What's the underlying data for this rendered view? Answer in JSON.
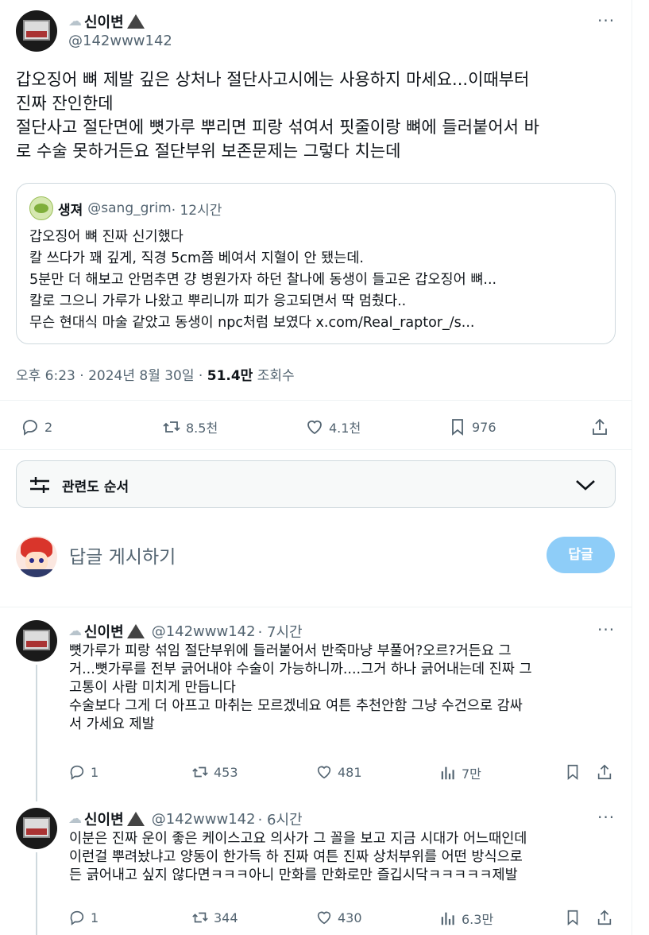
{
  "main_tweet": {
    "display_name": "신이변",
    "handle": "@142www142",
    "text_lines": [
      "갑오징어 뼈 제발 깊은 상처나 절단사고시에는 사용하지 마세요...이때부터",
      "진짜 잔인한데",
      "절단사고 절단면에 뼛가루 뿌리면 피랑 섞여서 핏줄이랑 뼈에 들러붙어서 바",
      "로 수술 못하거든요 절단부위 보존문제는 그렇다 치는데"
    ],
    "timestamp": "오후 6:23 · 2024년 8월 30일 · ",
    "views": "51.4만",
    "views_label": " 조회수",
    "stats": {
      "replies": "2",
      "retweets": "8.5천",
      "likes": "4.1천",
      "bookmarks": "976"
    }
  },
  "quote": {
    "display_name": "생져",
    "handle": "@sang_grim",
    "time": " · 12시간",
    "lines": [
      "갑오징어 뼈 진짜 신기했다",
      "칼 쓰다가 꽤 깊게, 직경 5cm쯤 베여서 지혈이 안 됐는데.",
      "5분만 더 해보고 안멈추면 걍 병원가자 하던 찰나에 동생이 들고온 갑오징어 뼈...",
      "칼로 그으니 가루가 나왔고 뿌리니까 피가 응고되면서 딱 멈췄다..",
      "무슨 현대식 마술 같았고 동생이 npc처럼 보였다 x.com/Real_raptor_/s..."
    ]
  },
  "sort": {
    "label": "관련도 순서"
  },
  "compose": {
    "placeholder": "답글 게시하기",
    "button": "답글"
  },
  "replies": [
    {
      "display_name": "신이변",
      "handle": "@142www142",
      "time": " · 7시간",
      "lines": [
        "뼛가루가 피랑 섞임 절단부위에 들러붙어서 반죽마냥 부풀어?오르?거든요 그",
        "거...뼛가루를 전부 긁어내야 수술이 가능하니까....그거 하나 긁어내는데 진짜 그",
        "고통이 사람 미치게 만듭니다",
        "수술보다 그게 더 아프고 마취는 모르겠네요 여튼 추천안함 그냥 수건으로 감싸",
        "서 가세요 제발"
      ],
      "stats": {
        "replies": "1",
        "retweets": "453",
        "likes": "481",
        "views": "7만"
      }
    },
    {
      "display_name": "신이변",
      "handle": "@142www142",
      "time": " · 6시간",
      "lines": [
        "이분은 진짜 운이 좋은 케이스고요 의사가 그 꼴을 보고 지금 시대가 어느때인데",
        "이런걸 뿌려놨냐고 양동이 한가득 하 진짜 여튼 진짜 상처부위를 어떤 방식으로",
        "든 긁어내고 싶지 않다면ㅋㅋㅋ아니 만화를 만화로만 즐깁시닥ㅋㅋㅋㅋㅋ제발"
      ],
      "stats": {
        "replies": "1",
        "retweets": "344",
        "likes": "430",
        "views": "6.3만"
      }
    }
  ],
  "colors": {
    "accent": "#1d9bf0",
    "reply_button_disabled": "#8ecdf8",
    "text": "#0f1419",
    "muted": "#536471",
    "border": "#cfd9de"
  }
}
